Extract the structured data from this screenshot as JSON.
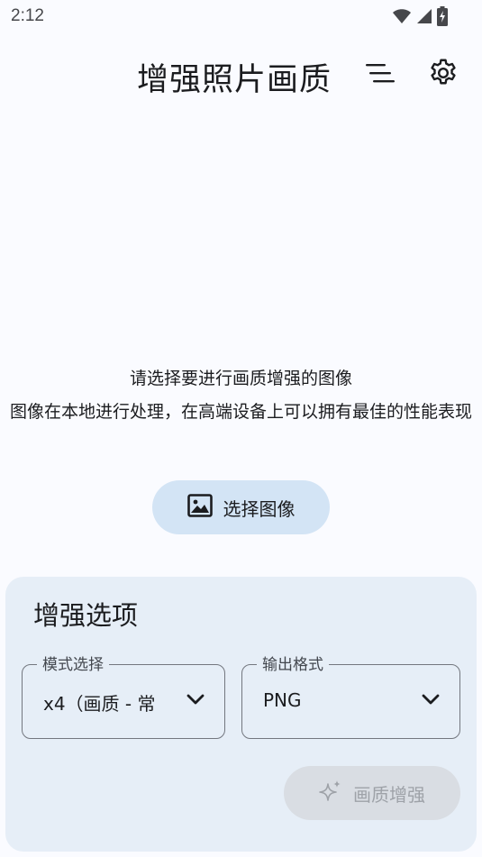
{
  "status_bar": {
    "time": "2:12",
    "icons": [
      "wifi-icon",
      "cellular-signal-icon",
      "battery-charging-icon"
    ]
  },
  "app_bar": {
    "title": "增强照片画质",
    "actions": [
      "sort-icon",
      "gear-icon"
    ]
  },
  "prompt": {
    "title": "请选择要进行画质增强的图像",
    "description": "图像在本地进行处理，在高端设备上可以拥有最佳的性能表现"
  },
  "select_image_button": {
    "label": "选择图像",
    "icon": "image-icon"
  },
  "options": {
    "title": "增强选项",
    "mode": {
      "label": "模式选择",
      "value": "x4（画质 - 常"
    },
    "format": {
      "label": "输出格式",
      "value": "PNG"
    },
    "enhance_button": {
      "label": "画质增强",
      "icon": "sparkle-icon",
      "enabled": false
    }
  },
  "colors": {
    "background": "#fafbff",
    "primary_container": "#d3e4f5",
    "card": "#e6eef7",
    "disabled_button": "#d9dde3",
    "outline": "#73777f"
  }
}
